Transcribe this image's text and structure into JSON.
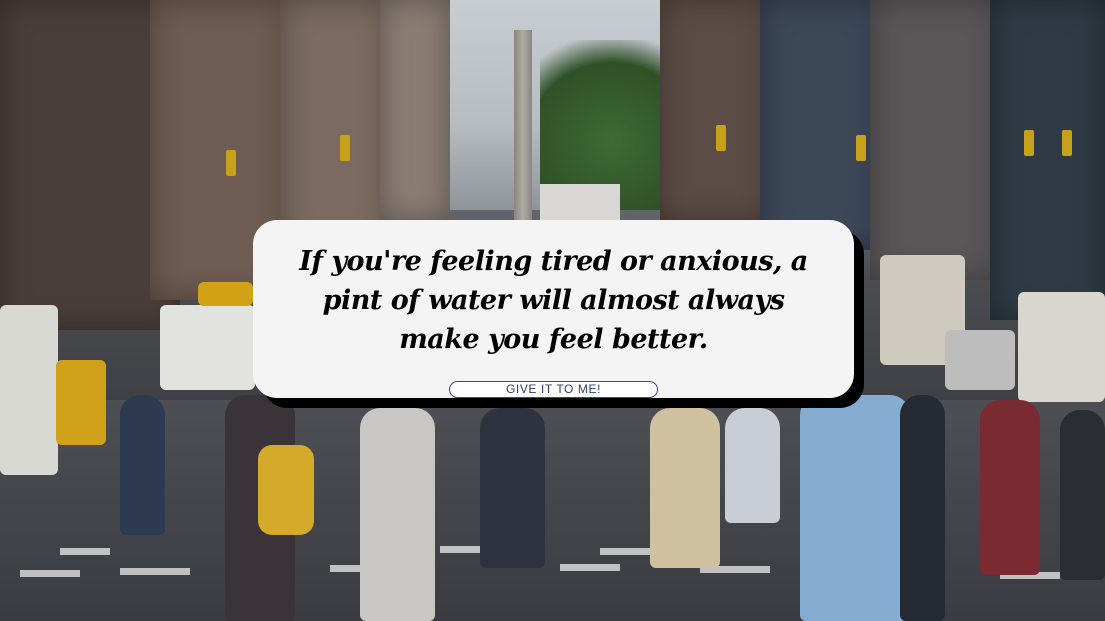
{
  "quote": {
    "text": "If you're feeling tired or anxious, a pint of water will almost always make you feel better."
  },
  "button": {
    "label": "GIVE IT TO ME!"
  },
  "background": {
    "icon": "city-street-photo"
  },
  "colors": {
    "card_bg": "#f4f4f4",
    "card_shadow": "#000000",
    "button_border": "#2b4d9a",
    "text": "#000000"
  }
}
